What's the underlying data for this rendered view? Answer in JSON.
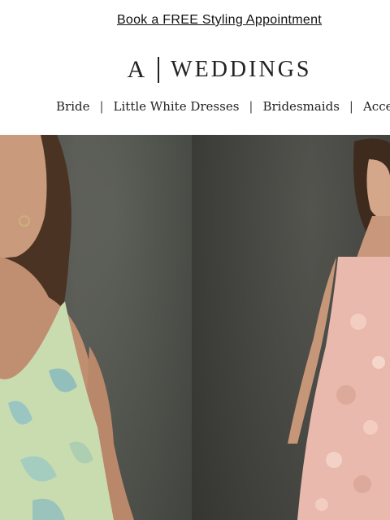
{
  "promo": {
    "label": "Book a FREE Styling Appointment"
  },
  "brand": {
    "mark": "A",
    "name": "WEDDINGS"
  },
  "nav": {
    "items": [
      "Bride",
      "Little White Dresses",
      "Bridesmaids",
      "Accessories"
    ],
    "separator": "|"
  },
  "hero": {
    "colors": {
      "left_dress": "#c9dcb0",
      "right_dress": "#e8b9ac",
      "backdrop": "#4b4c46"
    }
  }
}
